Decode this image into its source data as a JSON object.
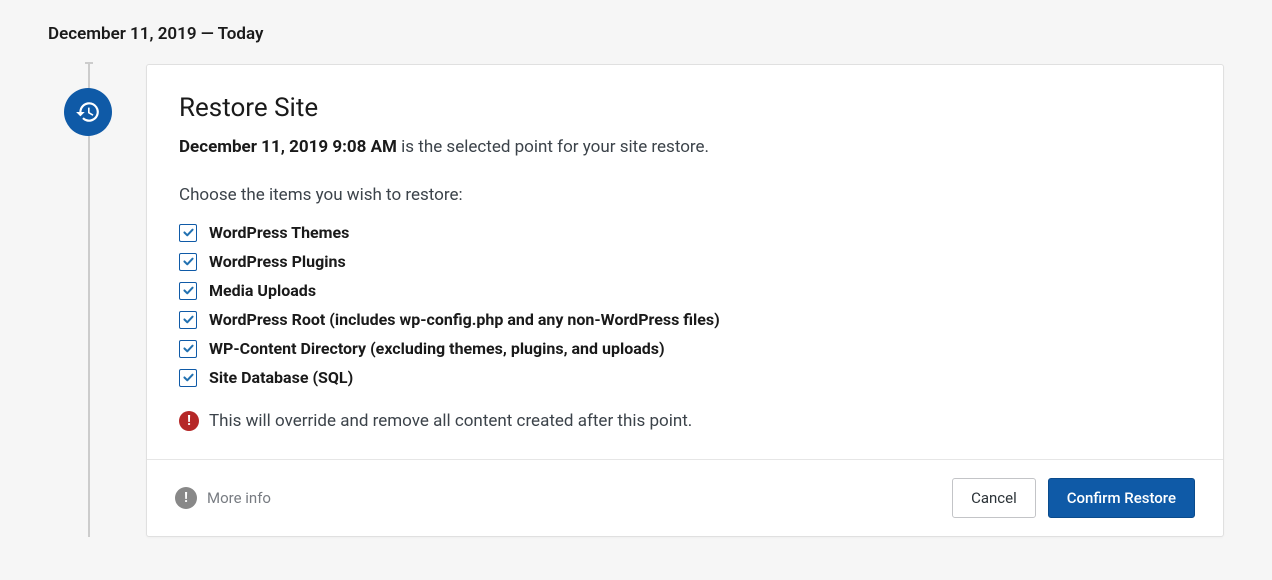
{
  "dateHeader": "December 11, 2019 — Today",
  "panel": {
    "title": "Restore Site",
    "selectedPointBold": "December 11, 2019 9:08 AM",
    "selectedPointRest": " is the selected point for your site restore.",
    "chooseLine": "Choose the items you wish to restore:",
    "items": [
      {
        "label": "WordPress Themes",
        "checked": true
      },
      {
        "label": "WordPress Plugins",
        "checked": true
      },
      {
        "label": "Media Uploads",
        "checked": true
      },
      {
        "label": "WordPress Root (includes wp-config.php and any non-WordPress files)",
        "checked": true
      },
      {
        "label": "WP-Content Directory (excluding themes, plugins, and uploads)",
        "checked": true
      },
      {
        "label": "Site Database (SQL)",
        "checked": true
      }
    ],
    "warningText": "This will override and remove all content created after this point."
  },
  "footer": {
    "moreInfo": "More info",
    "cancel": "Cancel",
    "confirm": "Confirm Restore"
  }
}
